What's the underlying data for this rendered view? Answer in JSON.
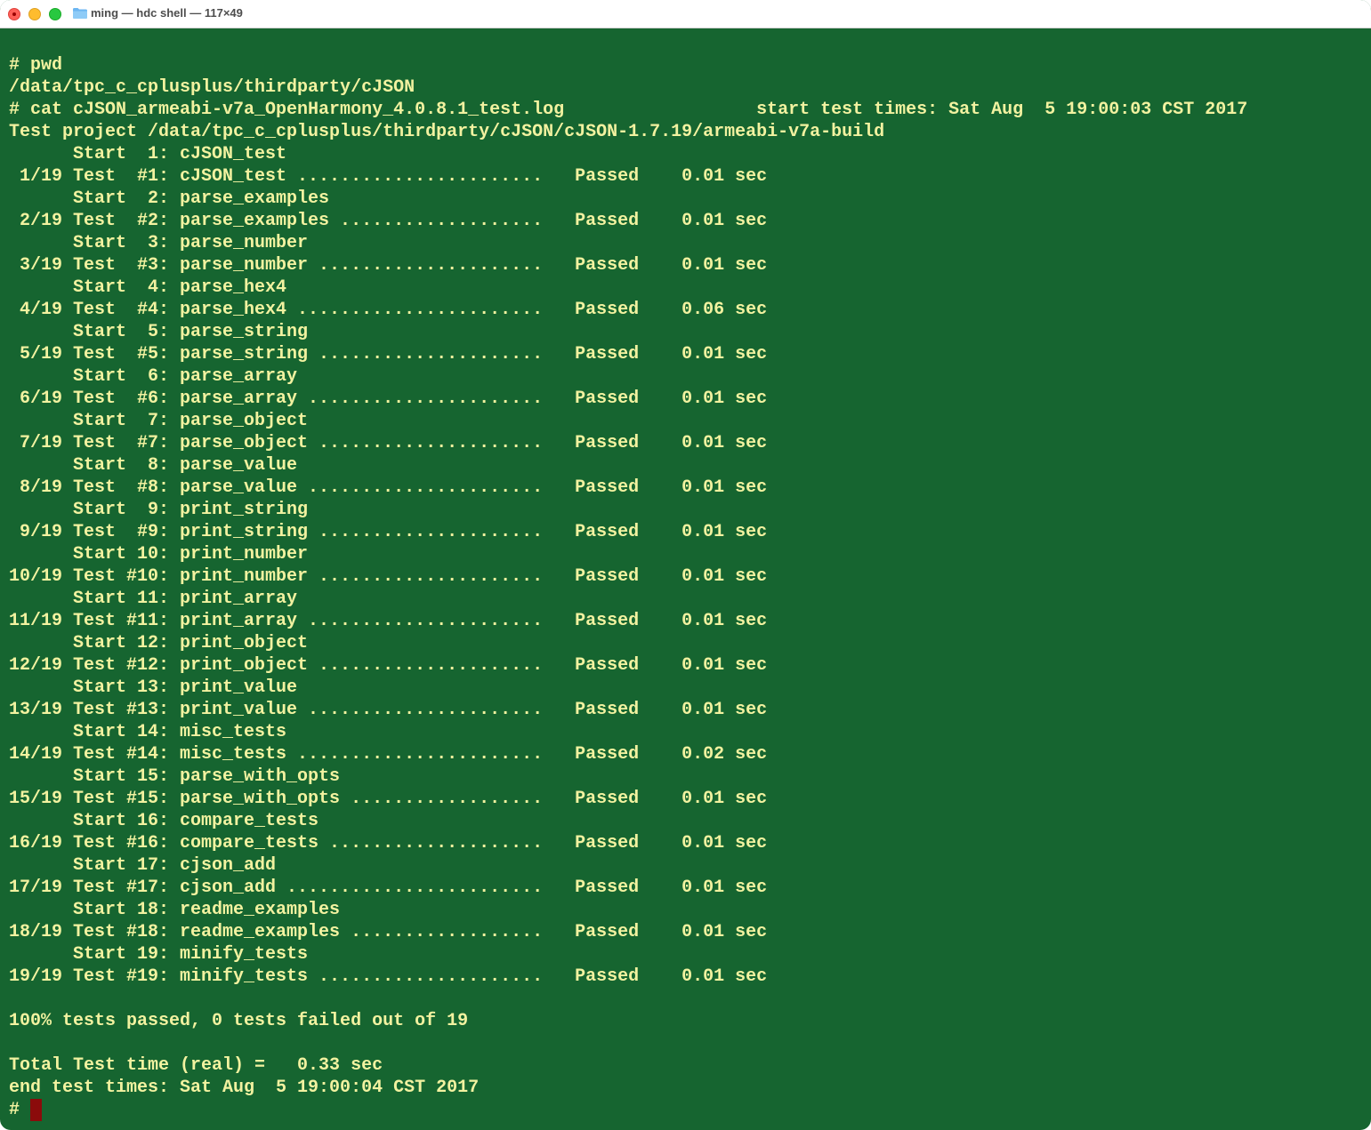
{
  "window": {
    "title": "ming — hdc shell — 117×49",
    "folder_icon": "folder-icon"
  },
  "colors": {
    "background": "#166530",
    "foreground": "#f2f2a0",
    "cursor": "#8b0b0b"
  },
  "terminal": {
    "lines": [
      "",
      "# pwd",
      "/data/tpc_c_cplusplus/thirdparty/cJSON",
      "# cat cJSON_armeabi-v7a_OpenHarmony_4.0.8.1_test.log                  start test times: Sat Aug  5 19:00:03 CST 2017",
      "Test project /data/tpc_c_cplusplus/thirdparty/cJSON/cJSON-1.7.19/armeabi-v7a-build",
      "      Start  1: cJSON_test",
      " 1/19 Test  #1: cJSON_test .......................   Passed    0.01 sec",
      "      Start  2: parse_examples",
      " 2/19 Test  #2: parse_examples ...................   Passed    0.01 sec",
      "      Start  3: parse_number",
      " 3/19 Test  #3: parse_number .....................   Passed    0.01 sec",
      "      Start  4: parse_hex4",
      " 4/19 Test  #4: parse_hex4 .......................   Passed    0.06 sec",
      "      Start  5: parse_string",
      " 5/19 Test  #5: parse_string .....................   Passed    0.01 sec",
      "      Start  6: parse_array",
      " 6/19 Test  #6: parse_array ......................   Passed    0.01 sec",
      "      Start  7: parse_object",
      " 7/19 Test  #7: parse_object .....................   Passed    0.01 sec",
      "      Start  8: parse_value",
      " 8/19 Test  #8: parse_value ......................   Passed    0.01 sec",
      "      Start  9: print_string",
      " 9/19 Test  #9: print_string .....................   Passed    0.01 sec",
      "      Start 10: print_number",
      "10/19 Test #10: print_number .....................   Passed    0.01 sec",
      "      Start 11: print_array",
      "11/19 Test #11: print_array ......................   Passed    0.01 sec",
      "      Start 12: print_object",
      "12/19 Test #12: print_object .....................   Passed    0.01 sec",
      "      Start 13: print_value",
      "13/19 Test #13: print_value ......................   Passed    0.01 sec",
      "      Start 14: misc_tests",
      "14/19 Test #14: misc_tests .......................   Passed    0.02 sec",
      "      Start 15: parse_with_opts",
      "15/19 Test #15: parse_with_opts ..................   Passed    0.01 sec",
      "      Start 16: compare_tests",
      "16/19 Test #16: compare_tests ....................   Passed    0.01 sec",
      "      Start 17: cjson_add",
      "17/19 Test #17: cjson_add ........................   Passed    0.01 sec",
      "      Start 18: readme_examples",
      "18/19 Test #18: readme_examples ..................   Passed    0.01 sec",
      "      Start 19: minify_tests",
      "19/19 Test #19: minify_tests .....................   Passed    0.01 sec",
      "",
      "100% tests passed, 0 tests failed out of 19",
      "",
      "Total Test time (real) =   0.33 sec",
      "end test times: Sat Aug  5 19:00:04 CST 2017"
    ],
    "prompt": "# "
  }
}
